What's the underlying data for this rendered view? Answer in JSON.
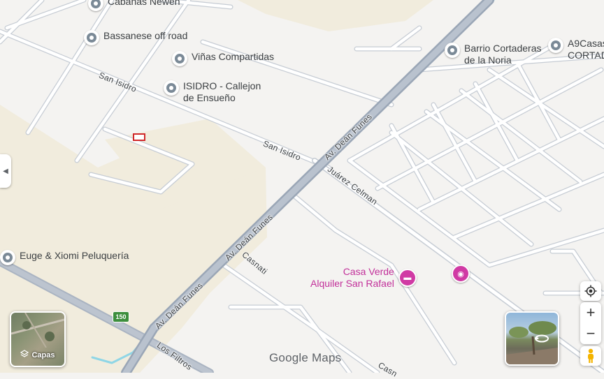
{
  "map": {
    "brand": "Google Maps",
    "pois": {
      "cabanas": "Cabanas Newen",
      "bassanese": "Bassanese off road",
      "vinas": "Viñas Compartidas",
      "isidro_1": "ISIDRO - Callejon",
      "isidro_2": "de Ensueño",
      "barrio_1": "Barrio Cortaderas",
      "barrio_2": "de la Noria",
      "a9_1": "A9Casas",
      "a9_2": "CORTAD",
      "euge": "Euge & Xiomi Peluquería",
      "casa_verde_1": "Casa Verde",
      "casa_verde_2": "Alquiler San Rafael"
    },
    "streets": {
      "san_isidro_1": "San Isidro",
      "san_isidro_2": "San Isidro",
      "dean_funes_1": "Av. Deán Funes",
      "dean_funes_2": "Av. Deán Funes",
      "dean_funes_3": "Av. Deán Funes",
      "juarez": "Juárez Celman",
      "casnati_1": "Casnati",
      "casnati_2": "Casn",
      "los_filtros": "Los Filtros"
    },
    "route_shield": "150",
    "colors": {
      "background": "#f4f3f1",
      "sand": "#f1ecdd",
      "road": "#ffffff",
      "road_edge": "#c6ccd4",
      "avenue": "#aab4c2",
      "water": "#8fd6e6",
      "poi_pink": "#c2309a",
      "marker_red": "#d0282a"
    }
  },
  "controls": {
    "layers_label": "Capas",
    "icons": {
      "collapse": "chevron-left-icon",
      "layers": "layers-icon",
      "location": "my-location-icon",
      "zoom_in": "plus-icon",
      "zoom_out": "minus-icon",
      "pegman": "pegman-icon",
      "rotate": "rotate-360-icon"
    },
    "zoom_in": "+",
    "zoom_out": "−"
  }
}
